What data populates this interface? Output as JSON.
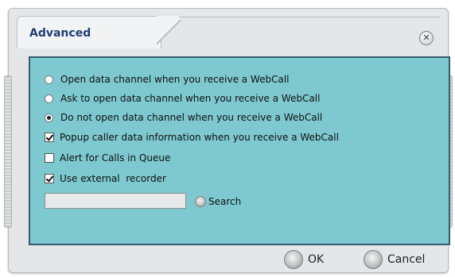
{
  "dialog": {
    "title": "Advanced",
    "close_icon": "close-icon",
    "close_glyph": "✕"
  },
  "options": [
    {
      "kind": "radio",
      "label": "Open data channel when you receive a WebCall",
      "checked": false
    },
    {
      "kind": "radio",
      "label": "Ask to open data channel when you receive a WebCall",
      "checked": false
    },
    {
      "kind": "radio",
      "label": "Do not open data channel when you receive a WebCall",
      "checked": true
    },
    {
      "kind": "checkbox",
      "label": "Popup caller data information when you receive a WebCall",
      "checked": true
    },
    {
      "kind": "checkbox",
      "label": "Alert for Calls in Queue",
      "checked": false
    },
    {
      "kind": "checkbox",
      "label": "Use external  recorder",
      "checked": true
    }
  ],
  "recorder": {
    "input_value": "",
    "search_label": "Search"
  },
  "footer": {
    "ok_label": "OK",
    "cancel_label": "Cancel"
  },
  "colors": {
    "panel_bg": "#7dc9cf",
    "panel_border": "#365a6f",
    "title_text": "#1f3e73",
    "dialog_bg": "#e4e6e7"
  }
}
